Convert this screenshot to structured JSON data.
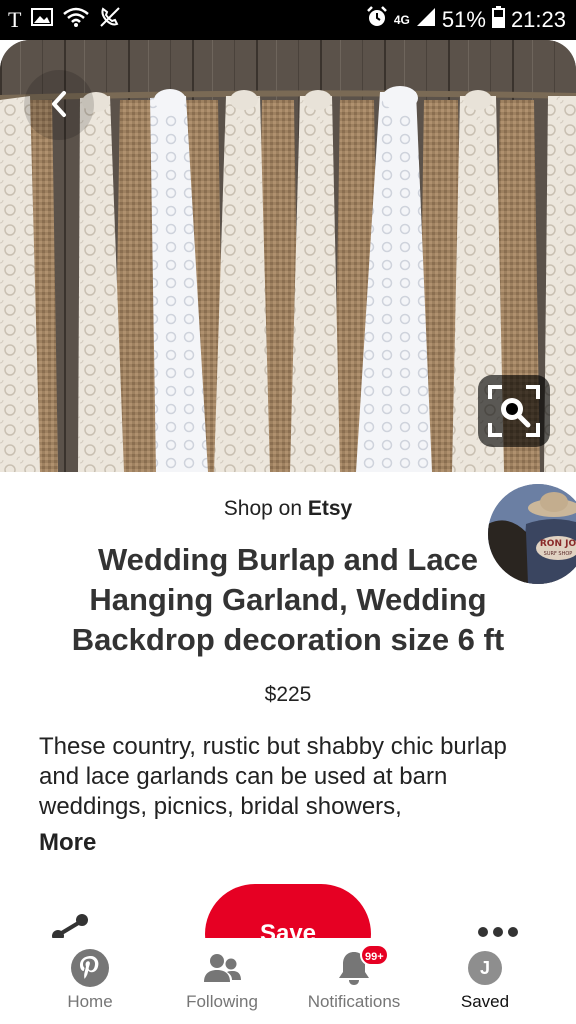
{
  "status_bar": {
    "left_icons": [
      "t-icon",
      "image-icon",
      "wifi-icon",
      "no-call-icon"
    ],
    "t_label": "T",
    "network": "4G",
    "battery": "51%",
    "time": "21:23"
  },
  "product": {
    "shop_prefix": "Shop on",
    "shop_name": "Etsy",
    "title": "Wedding Burlap and Lace Hanging Garland, Wedding Backdrop decoration size 6 ft",
    "price": "$225",
    "description": "These country, rustic but shabby chic burlap and lace garlands can be used at barn weddings, picnics, bridal showers,",
    "more_label": "More"
  },
  "actions": {
    "save_label": "Save"
  },
  "bottom_nav": {
    "items": [
      {
        "label": "Home",
        "icon": "pinterest-icon"
      },
      {
        "label": "Following",
        "icon": "people-icon"
      },
      {
        "label": "Notifications",
        "icon": "bell-icon",
        "badge": "99+"
      },
      {
        "label": "Saved",
        "icon": "profile-icon",
        "avatar_letter": "J"
      }
    ]
  },
  "colors": {
    "brand_red": "#e60023",
    "status_bar": "#000000",
    "inactive_nav": "#767676"
  }
}
